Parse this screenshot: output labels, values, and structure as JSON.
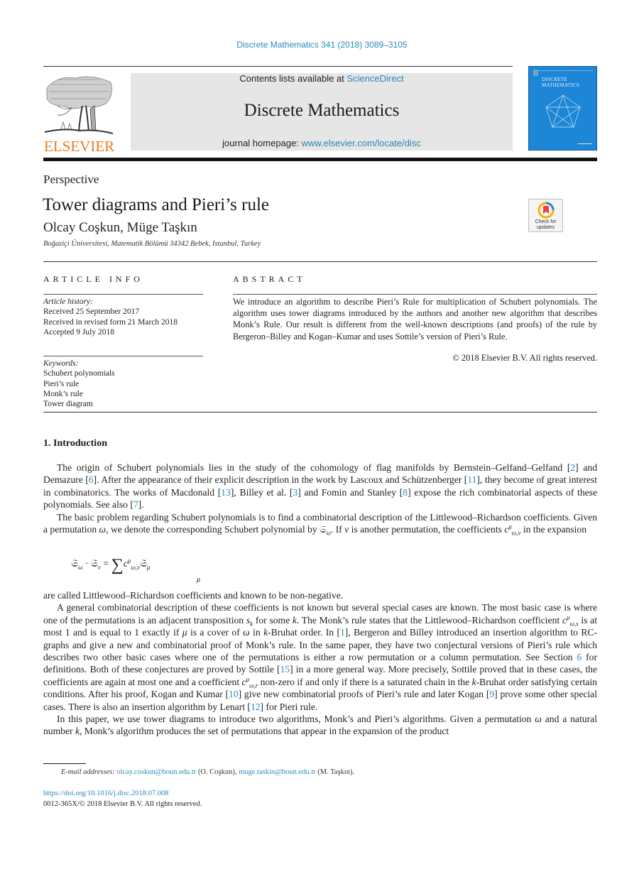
{
  "header": {
    "journal_reference": "Discrete Mathematics 341 (2018) 3089–3105",
    "publisher_wordmark": "ELSEVIER",
    "contents_prefix": "Contents lists available at ",
    "contents_link": "ScienceDirect",
    "journal_title": "Discrete Mathematics",
    "homepage_prefix": "journal homepage: ",
    "homepage_link": "www.elsevier.com/locate/disc",
    "cover_title_line1": "DISCRETE",
    "cover_title_line2": "MATHEMATICS",
    "colors": {
      "link": "#2a8ab8",
      "elsevier_orange": "#f07a1c",
      "cover_blue": "#1d86d6",
      "band_gray": "#e6e6e6"
    }
  },
  "article": {
    "type": "Perspective",
    "title": "Tower diagrams and Pieri’s rule",
    "authors": "Olcay Coşkun, Müge Taşkın",
    "affiliation": "Boğaziçi Üniversitesi, Matematik Bölümü 34342 Bebek, Istanbul, Turkey",
    "check_updates_line1": "Check for",
    "check_updates_line2": "updates"
  },
  "article_info": {
    "heading": "ARTICLE INFO",
    "history_label": "Article history:",
    "history": [
      "Received 25 September 2017",
      "Received in revised form 21 March 2018",
      "Accepted 9 July 2018"
    ],
    "keywords_label": "Keywords:",
    "keywords": [
      "Schubert polynomials",
      "Pieri’s rule",
      "Monk’s rule",
      "Tower diagram"
    ]
  },
  "abstract": {
    "heading": "ABSTRACT",
    "text": "We introduce an algorithm to describe Pieri’s Rule for multiplication of Schubert polynomials. The algorithm uses tower diagrams introduced by the authors and another new algorithm that describes Monk’s Rule. Our result is different from the well-known descriptions (and proofs) of the rule by Bergeron–Billey  and Kogan–Kumar and uses Sottile’s version of Pieri’s Rule.",
    "copyright": "© 2018 Elsevier B.V. All rights reserved."
  },
  "introduction": {
    "heading": "1.  Introduction",
    "p1": {
      "t1": "The origin of Schubert polynomials lies in the study of the cohomology of flag manifolds by Bernstein–Gelfand–Gelfand [",
      "r1": "2",
      "t2": "] and Demazure [",
      "r2": "6",
      "t3": "]. After the appearance of their explicit description in the work by Lascoux and Schützenberger [",
      "r3": "11",
      "t4": "], they become of great interest in combinatorics. The works of Macdonald [",
      "r4": "13",
      "t5": "], Billey et al. [",
      "r5": "3",
      "t6": "] and Fomin and Stanley [",
      "r6": "8",
      "t7": "] expose the rich combinatorial aspects of these polynomials. See also [",
      "r7": "7",
      "t8": "]."
    },
    "p2": {
      "t1": "The basic problem regarding Schubert polynomials is to find a combinatorial description of the Littlewood–Richardson coefficients. Given a permutation ",
      "omega": "ω",
      "t2": ", we denote the corresponding Schubert polynomial by ",
      "S": "𝔖",
      "t3": ". If ",
      "nu": "ν",
      "t4": " is another permutation, the coefficients ",
      "c": "c",
      "mu": "μ",
      "sub_omega_nu": "ω,ν",
      "t5": " in the expansion"
    },
    "equation": {
      "S": "𝔖",
      "omega": "ω",
      "dot": " · ",
      "nu": "ν",
      "eq": " = ",
      "sum": "∑",
      "c": "c",
      "mu": "μ",
      "sub_omega_nu": "ω,ν",
      "sum_index": "μ"
    },
    "p3": {
      "t0": "are called Littlewood–Richardson coefficients and known to be non-negative.",
      "t1": "A general combinatorial description of these coefficients is not known but several special cases are known. The most basic case is where one of the permutations is an adjacent transposition ",
      "s": "s",
      "k": "k",
      "t2": " for some ",
      "t3": ". The Monk’s rule states that the Littlewood–Richardson coefficient ",
      "c": "c",
      "mu": "μ",
      "sub_omega_sk": "ω,s",
      "t4": " is at most 1 and is equal to 1 exactly if ",
      "t5": " is a cover of ",
      "omega": "ω",
      "t6": " in ",
      "t7": "-Bruhat order. In [",
      "r1": "1",
      "t8": "], Bergeron and Billey introduced an insertion algorithm to RC-graphs and give a new and combinatorial proof of Monk’s rule. In the same paper, they have two conjectural versions of Pieri’s rule which describes two other basic cases where one of the permutations is either a row permutation or a column permutation. See Section ",
      "r2": "6",
      "t9": " for definitions. Both of these conjectures are proved by Sottile [",
      "r3": "15",
      "t10": "] in a more general way. More precisely, Sottile proved that in these cases, the coefficients are again at most one and a coefficient ",
      "sub_omega_r": "ω,r",
      "t11": " non-zero if and only if there is a saturated chain in the ",
      "t12": "-Bruhat order satisfying certain conditions. After his proof, Kogan and Kumar [",
      "r4": "10",
      "t13": "] give new combinatorial proofs of Pieri’s rule and later Kogan [",
      "r5": "9",
      "t14": "] prove some other special cases. There is also an insertion algorithm by Lenart [",
      "r6": "12",
      "t15": "] for Pieri rule.",
      "t16": "In this paper, we use tower diagrams to introduce two algorithms, Monk’s and Pieri’s algorithms. Given a permutation ",
      "t17": " and a natural number ",
      "t18": ", Monk’s algorithm produces the set of permutations that appear in the expansion of the product"
    }
  },
  "footer": {
    "email_label": "E-mail addresses: ",
    "email1": "olcay.coskun@boun.edu.tr",
    "name1": " (O. Coşkun), ",
    "email2": "muge.taskin@boun.edu.tr",
    "name2": " (M. Taşkın).",
    "doi": "https://doi.org/10.1016/j.disc.2018.07.008",
    "issn": "0012-365X/© 2018 Elsevier B.V. All rights reserved."
  }
}
